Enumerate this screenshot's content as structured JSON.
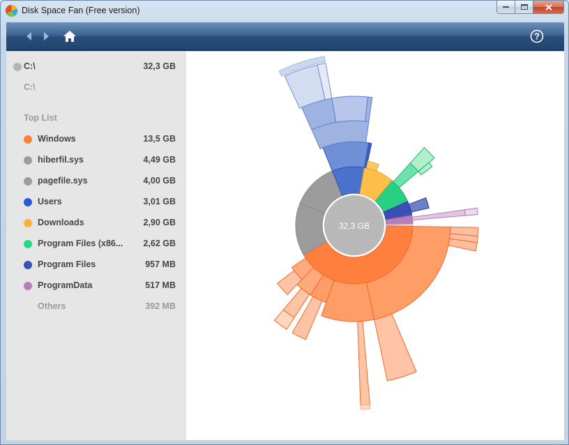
{
  "window": {
    "title": "Disk Space Fan (Free version)"
  },
  "nav": {
    "back_icon": "back-arrow-icon",
    "forward_icon": "forward-arrow-icon",
    "home_icon": "home-icon",
    "help_icon": "help-icon",
    "help_glyph": "?"
  },
  "sidebar": {
    "drive": {
      "label": "C:\\",
      "size": "32,3 GB"
    },
    "path": "C:\\",
    "top_list_label": "Top List",
    "items": [
      {
        "label": "Windows",
        "size": "13,5 GB",
        "color": "#ff7f3f"
      },
      {
        "label": "hiberfil.sys",
        "size": "4,49 GB",
        "color": "#9c9c9c"
      },
      {
        "label": "pagefile.sys",
        "size": "4,00 GB",
        "color": "#9c9c9c"
      },
      {
        "label": "Users",
        "size": "3,01 GB",
        "color": "#2a5bd7"
      },
      {
        "label": "Downloads",
        "size": "2,90 GB",
        "color": "#ffb33a"
      },
      {
        "label": "Program Files (x86...",
        "size": "2,62 GB",
        "color": "#22d98a"
      },
      {
        "label": "Program Files",
        "size": "957 MB",
        "color": "#3c4fb8"
      },
      {
        "label": "ProgramData",
        "size": "517 MB",
        "color": "#b77fb8"
      }
    ],
    "others": {
      "label": "Others",
      "size": "392 MB"
    }
  },
  "chart": {
    "center_label": "32,3 GB"
  }
}
